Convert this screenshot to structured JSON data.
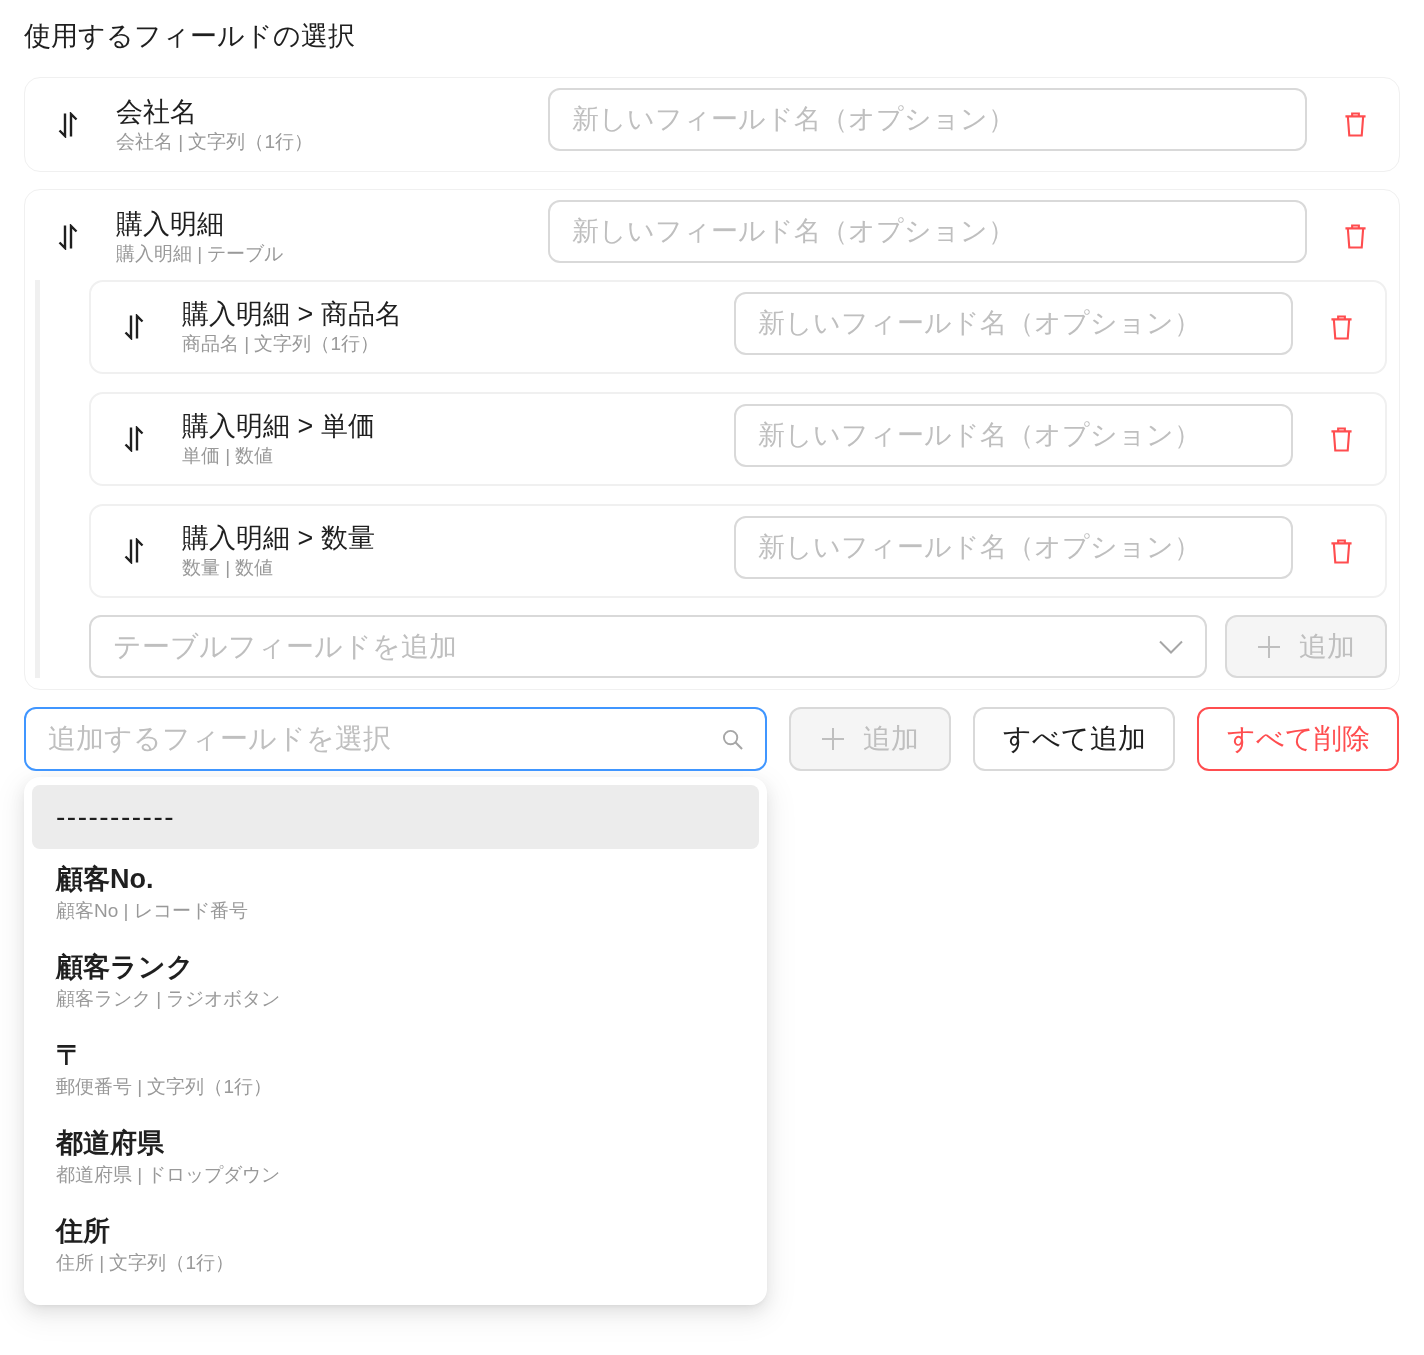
{
  "title": "使用するフィールドの選択",
  "fields": [
    {
      "name": "会社名",
      "detail": "会社名 | 文字列（1行）",
      "input": {
        "placeholder": "新しいフィールド名（オプション）"
      }
    },
    {
      "name": "購入明細",
      "detail": "購入明細 | テーブル",
      "input": {
        "placeholder": "新しいフィールド名（オプション）"
      },
      "children": [
        {
          "name": "購入明細 > 商品名",
          "detail": "商品名 | 文字列（1行）",
          "input": {
            "placeholder": "新しいフィールド名（オプション）"
          }
        },
        {
          "name": "購入明細 > 単価",
          "detail": "単価 | 数値",
          "input": {
            "placeholder": "新しいフィールド名（オプション）"
          }
        },
        {
          "name": "購入明細 > 数量",
          "detail": "数量 | 数値",
          "input": {
            "placeholder": "新しいフィールド名（オプション）"
          }
        }
      ],
      "table_field_select": {
        "placeholder": "テーブルフィールドを追加"
      },
      "add_button": {
        "label": "追加",
        "disabled": true
      }
    }
  ],
  "field_picker": {
    "search": {
      "placeholder": "追加するフィールドを選択",
      "focused": true
    },
    "buttons": [
      {
        "kind": "add",
        "label": "追加",
        "disabled": true
      },
      {
        "kind": "secondary",
        "label": "すべて追加",
        "disabled": false
      },
      {
        "kind": "danger",
        "label": "すべて削除",
        "disabled": false
      }
    ],
    "dropdown": {
      "options": [
        {
          "kind": "placeholder",
          "label": "-----------",
          "selected": true
        },
        {
          "kind": "field",
          "name": "顧客No.",
          "detail": "顧客No | レコード番号",
          "selected": false
        },
        {
          "kind": "field",
          "name": "顧客ランク",
          "detail": "顧客ランク | ラジオボタン",
          "selected": false
        },
        {
          "kind": "field",
          "name": "〒",
          "detail": "郵便番号 | 文字列（1行）",
          "selected": false
        },
        {
          "kind": "field",
          "name": "都道府県",
          "detail": "都道府県 | ドロップダウン",
          "selected": false
        },
        {
          "kind": "field",
          "name": "住所",
          "detail": "住所 | 文字列（1行）",
          "selected": false
        }
      ]
    }
  }
}
